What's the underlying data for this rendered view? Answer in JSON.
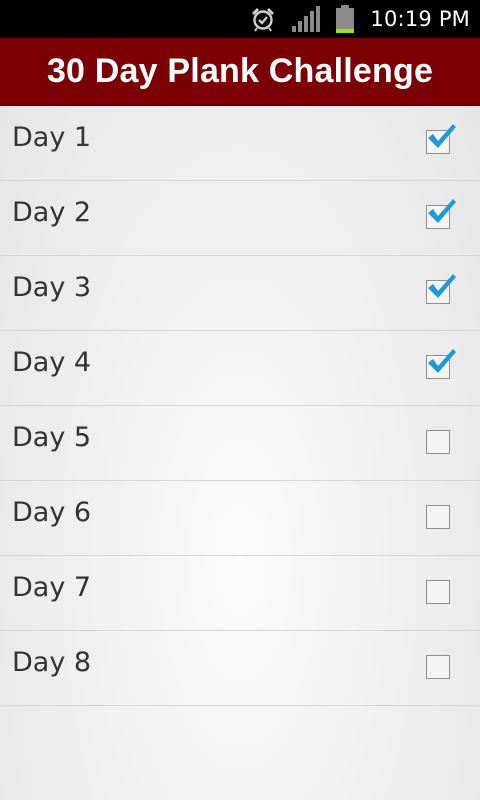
{
  "status_bar": {
    "time": "10:19 PM",
    "icons": [
      "alarm-icon",
      "signal-icon",
      "battery-icon"
    ]
  },
  "header": {
    "title": "30 Day Plank Challenge"
  },
  "colors": {
    "header_bg": "#7a0006",
    "check_blue": "#1e9ad6"
  },
  "days": [
    {
      "label": "Day 1",
      "checked": true
    },
    {
      "label": "Day 2",
      "checked": true
    },
    {
      "label": "Day 3",
      "checked": true
    },
    {
      "label": "Day 4",
      "checked": true
    },
    {
      "label": "Day 5",
      "checked": false
    },
    {
      "label": "Day 6",
      "checked": false
    },
    {
      "label": "Day 7",
      "checked": false
    },
    {
      "label": "Day 8",
      "checked": false
    }
  ]
}
